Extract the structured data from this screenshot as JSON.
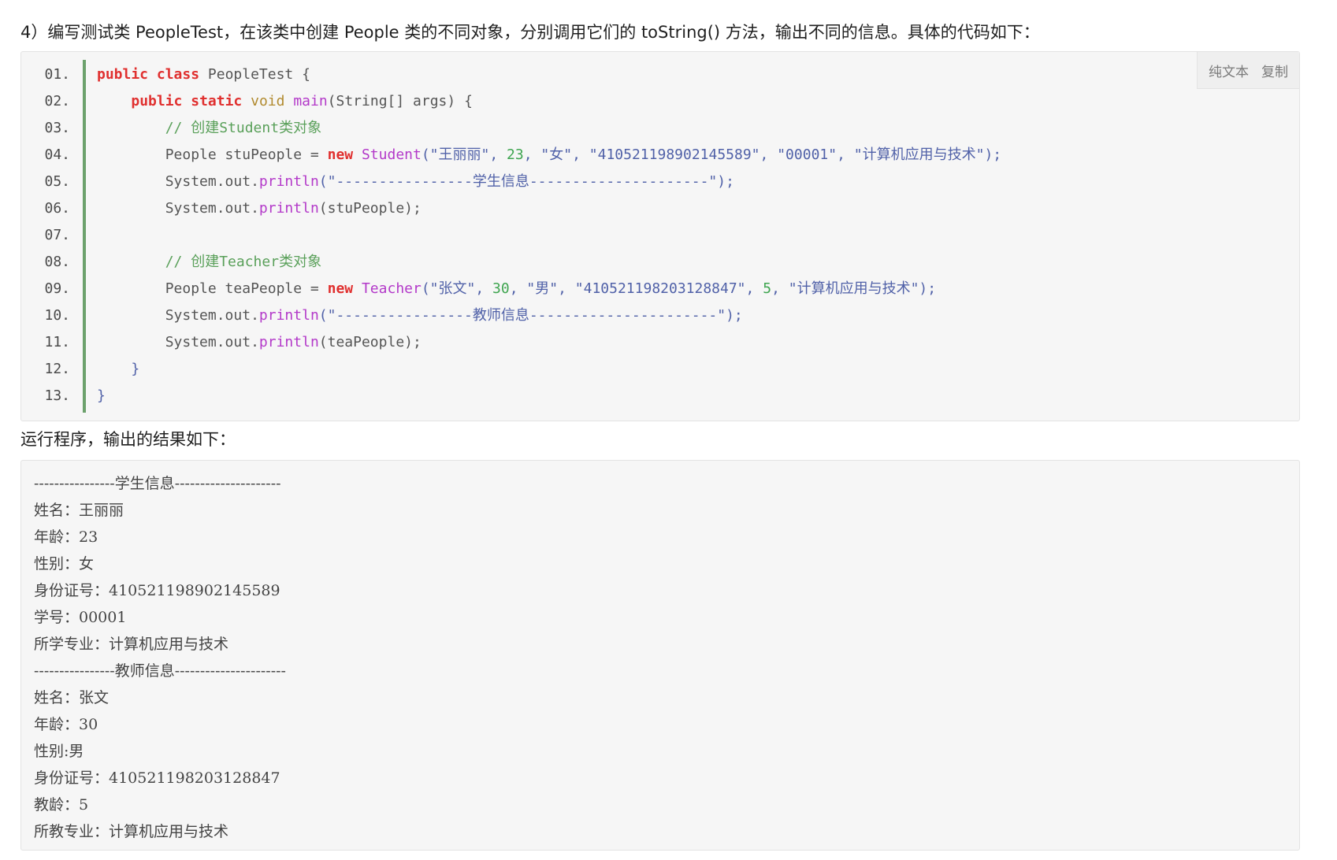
{
  "intro_text": "4）编写测试类 PeopleTest，在该类中创建 People 类的不同对象，分别调用它们的 toString() 方法，输出不同的信息。具体的代码如下：",
  "toolbar": {
    "plain_text_label": "纯文本",
    "copy_label": "复制"
  },
  "line_numbers": [
    "01.",
    "02.",
    "03.",
    "04.",
    "05.",
    "06.",
    "07.",
    "08.",
    "09.",
    "10.",
    "11.",
    "12.",
    "13."
  ],
  "code": {
    "l1": {
      "kw1": "public",
      "kw2": "class",
      "rest": " PeopleTest {"
    },
    "l2": {
      "kw1": "public",
      "kw2": "static",
      "ty": "void",
      "fn": "main",
      "rest": "(String[] args) {"
    },
    "l3": {
      "comment": "// 创建Student类对象"
    },
    "l4": {
      "pre": "People stuPeople = ",
      "kw": "new",
      "cls": "Student",
      "s1": "(\"王丽丽\"",
      "sep1": ", ",
      "n1": "23",
      "sep2": ", ",
      "s2": "\"女\"",
      "sep3": ", ",
      "s3": "\"410521198902145589\"",
      "sep4": ", ",
      "s4": "\"00001\"",
      "sep5": ", ",
      "s5": "\"计算机应用与技术\");"
    },
    "l5": {
      "pre": "System.out.",
      "fn": "println",
      "s": "(\"----------------学生信息---------------------\");"
    },
    "l6": {
      "pre": "System.out.",
      "fn": "println",
      "s": "(stuPeople);"
    },
    "l8": {
      "comment": "// 创建Teacher类对象"
    },
    "l9": {
      "pre": "People teaPeople = ",
      "kw": "new",
      "cls": "Teacher",
      "s1": "(\"张文\"",
      "sep1": ", ",
      "n1": "30",
      "sep2": ", ",
      "s2": "\"男\"",
      "sep3": ", ",
      "s3": "\"410521198203128847\"",
      "sep4": ", ",
      "n2": "5",
      "sep5": ", ",
      "s5": "\"计算机应用与技术\");"
    },
    "l10": {
      "pre": "System.out.",
      "fn": "println",
      "s": "(\"----------------教师信息----------------------\");"
    },
    "l11": {
      "pre": "System.out.",
      "fn": "println",
      "s": "(teaPeople);"
    },
    "l12": {
      "rest": "}"
    },
    "l13": {
      "rest": "}"
    }
  },
  "result_heading": "运行程序，输出的结果如下：",
  "output_lines": [
    "----------------学生信息---------------------",
    "姓名：王丽丽",
    "年龄：23",
    "性别：女",
    "身份证号：410521198902145589",
    "学号：00001",
    "所学专业：计算机应用与技术",
    "----------------教师信息----------------------",
    "姓名：张文",
    "年龄：30",
    "性别:男",
    "身份证号：410521198203128847",
    "教龄：5",
    "所教专业：计算机应用与技术"
  ]
}
